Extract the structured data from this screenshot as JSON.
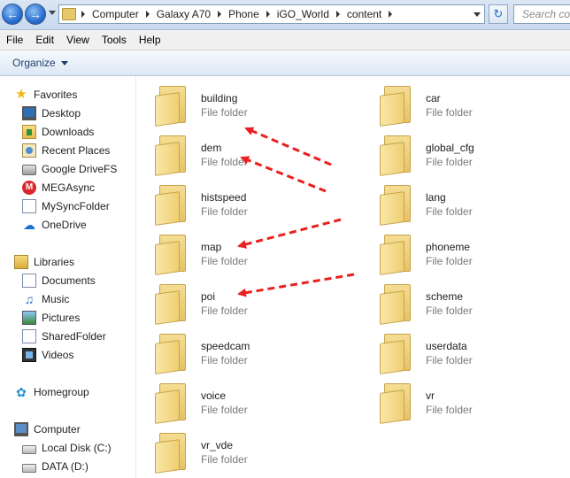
{
  "address": {
    "crumbs": [
      "Computer",
      "Galaxy A70",
      "Phone",
      "iGO_World",
      "content"
    ],
    "search_placeholder": "Search co"
  },
  "menu": [
    "File",
    "Edit",
    "View",
    "Tools",
    "Help"
  ],
  "command_bar": {
    "organize": "Organize"
  },
  "nav": {
    "favorites": {
      "label": "Favorites",
      "items": [
        "Desktop",
        "Downloads",
        "Recent Places",
        "Google DriveFS",
        "MEGAsync",
        "MySyncFolder",
        "OneDrive"
      ]
    },
    "libraries": {
      "label": "Libraries",
      "items": [
        "Documents",
        "Music",
        "Pictures",
        "SharedFolder",
        "Videos"
      ]
    },
    "homegroup": "Homegroup",
    "computer": {
      "label": "Computer",
      "items": [
        "Local Disk (C:)",
        "DATA (D:)"
      ]
    }
  },
  "folders": [
    {
      "name": "building",
      "type": "File folder"
    },
    {
      "name": "car",
      "type": "File folder"
    },
    {
      "name": "dem",
      "type": "File folder"
    },
    {
      "name": "global_cfg",
      "type": "File folder"
    },
    {
      "name": "histspeed",
      "type": "File folder"
    },
    {
      "name": "lang",
      "type": "File folder"
    },
    {
      "name": "map",
      "type": "File folder"
    },
    {
      "name": "phoneme",
      "type": "File folder"
    },
    {
      "name": "poi",
      "type": "File folder"
    },
    {
      "name": "scheme",
      "type": "File folder"
    },
    {
      "name": "speedcam",
      "type": "File folder"
    },
    {
      "name": "userdata",
      "type": "File folder"
    },
    {
      "name": "voice",
      "type": "File folder"
    },
    {
      "name": "vr",
      "type": "File folder"
    },
    {
      "name": "vr_vde",
      "type": "File folder"
    }
  ],
  "annotation_color": "#e8201f"
}
